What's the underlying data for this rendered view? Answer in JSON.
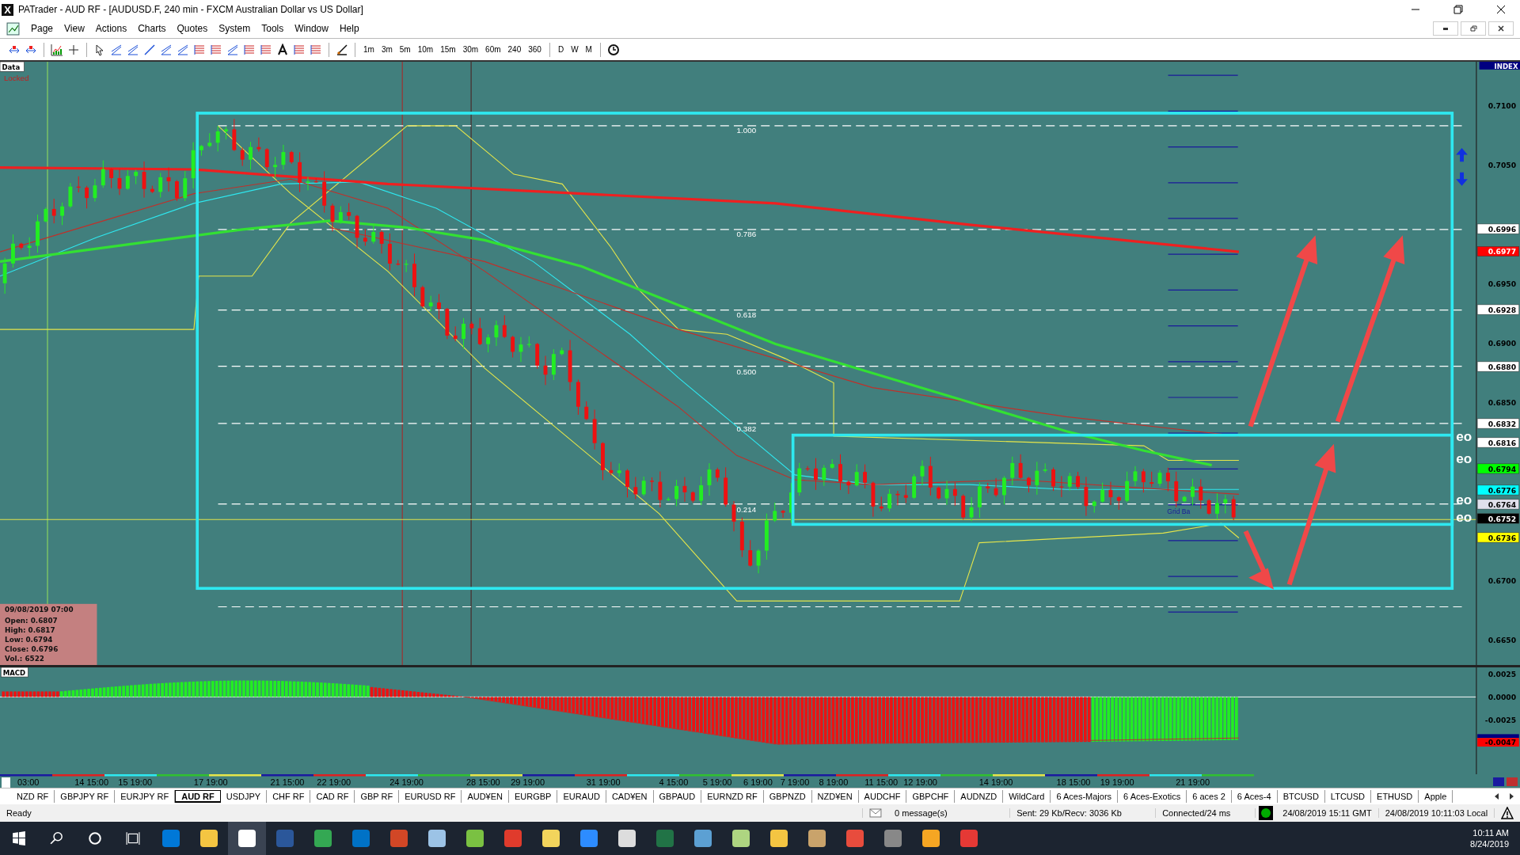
{
  "window": {
    "logo": "X",
    "title": "PATrader - AUD RF - [AUDUSD.F, 240 min - FXCM Australian Dollar vs US Dollar]"
  },
  "menu": [
    "Page",
    "View",
    "Actions",
    "Charts",
    "Quotes",
    "System",
    "Tools",
    "Window",
    "Help"
  ],
  "timeframes": [
    "1m",
    "3m",
    "5m",
    "10m",
    "15m",
    "30m",
    "60m",
    "240",
    "360"
  ],
  "periods": [
    "D",
    "W",
    "M"
  ],
  "chart": {
    "data_label": "Data",
    "locked_label": "Locked",
    "index_label": "INDEX",
    "price_labels": [
      "0.7100",
      "0.7050",
      "0.6950",
      "0.6900",
      "0.6850",
      "0.6700",
      "0.6650"
    ],
    "price_tags": [
      {
        "text": "0.6996",
        "color": "#ffffff"
      },
      {
        "text": "0.6977",
        "color": "#ff0000"
      },
      {
        "text": "0.6928",
        "color": "#ffffff"
      },
      {
        "text": "0.6880",
        "color": "#ffffff"
      },
      {
        "text": "0.6832",
        "color": "#ffffff"
      },
      {
        "text": "0.6816",
        "color": "#ffffff"
      },
      {
        "text": "0.6794",
        "color": "#00ff00"
      },
      {
        "text": "0.6776",
        "color": "#00ffff"
      },
      {
        "text": "0.6764",
        "color": "#e0e0ec"
      },
      {
        "text": "0.6752",
        "color": "#000000"
      },
      {
        "text": "0.6736",
        "color": "#ffff00"
      }
    ],
    "fib_levels": [
      "1.000",
      "0.786",
      "0.618",
      "0.500",
      "0.382",
      "0.214"
    ],
    "eo_markers": [
      "eo",
      "eo",
      "eo",
      "eo"
    ],
    "grid_label": "Grid Ba",
    "info_box": {
      "date": "09/08/2019 07:00",
      "lines": [
        "Open: 0.6807",
        "High: 0.6817",
        "Low: 0.6794",
        "Close: 0.6796",
        "Vol.: 6522"
      ]
    }
  },
  "macd": {
    "label": "MACD",
    "axis_labels": [
      "0.0025",
      "0.0000",
      "-0.0025"
    ],
    "tag": {
      "text": "-0.0047",
      "color": "#ff0000"
    }
  },
  "time_axis": [
    "03:00",
    "14 15:00",
    "15 19:00",
    "17 19:00",
    "21 15:00",
    "22 19:00",
    "24 19:00",
    "28 15:00",
    "29 19:00",
    "31 19:00",
    "4 15:00",
    "5 19:00",
    "6 19:00",
    "7 19:00",
    "8 19:00",
    "11 15:00",
    "12 19:00",
    "14 19:00",
    "18 15:00",
    "19 19:00",
    "21 19:00"
  ],
  "tabs": [
    {
      "label": "NZD RF",
      "selected": false
    },
    {
      "label": "GBPJPY RF",
      "selected": false
    },
    {
      "label": "EURJPY RF",
      "selected": false
    },
    {
      "label": "AUD RF",
      "selected": true
    },
    {
      "label": "USDJPY",
      "selected": false
    },
    {
      "label": "CHF RF",
      "selected": false
    },
    {
      "label": "CAD RF",
      "selected": false
    },
    {
      "label": "GBP RF",
      "selected": false
    },
    {
      "label": "EURUSD RF",
      "selected": false
    },
    {
      "label": "AUD¥EN",
      "selected": false
    },
    {
      "label": "EURGBP",
      "selected": false
    },
    {
      "label": "EURAUD",
      "selected": false
    },
    {
      "label": "CAD¥EN",
      "selected": false
    },
    {
      "label": "GBPAUD",
      "selected": false
    },
    {
      "label": "EURNZD RF",
      "selected": false
    },
    {
      "label": "GBPNZD",
      "selected": false
    },
    {
      "label": "NZD¥EN",
      "selected": false
    },
    {
      "label": "AUDCHF",
      "selected": false
    },
    {
      "label": "GBPCHF",
      "selected": false
    },
    {
      "label": "AUDNZD",
      "selected": false
    },
    {
      "label": "WildCard",
      "selected": false
    },
    {
      "label": "6 Aces-Majors",
      "selected": false
    },
    {
      "label": "6 Aces-Exotics",
      "selected": false
    },
    {
      "label": "6 aces 2",
      "selected": false
    },
    {
      "label": "6 Aces-4",
      "selected": false
    },
    {
      "label": "BTCUSD",
      "selected": false
    },
    {
      "label": "LTCUSD",
      "selected": false
    },
    {
      "label": "ETHUSD",
      "selected": false
    },
    {
      "label": "Apple",
      "selected": false
    }
  ],
  "status_bar": {
    "ready": "Ready",
    "messages": "0 message(s)",
    "traffic": "Sent: 29 Kb/Recv: 3036 Kb",
    "connection": "Connected/24 ms",
    "gmt_time": "24/08/2019 15:11 GMT",
    "local_time": "24/08/2019 10:11:03 Local"
  },
  "taskbar": {
    "time": "10:11 AM",
    "date": "8/24/2019"
  }
}
